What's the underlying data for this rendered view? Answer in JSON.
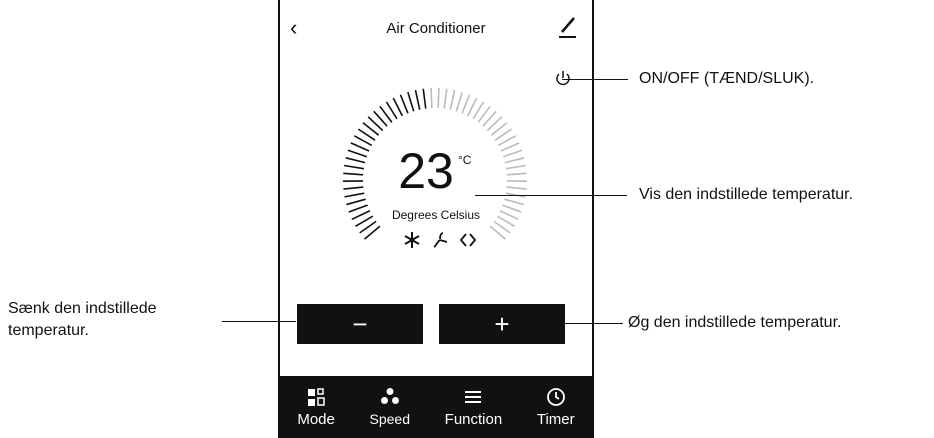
{
  "app": {
    "back_icon": "chevron-left-icon",
    "title": "Air Conditioner",
    "edit_icon": "pencil-icon",
    "power_icon": "power-icon"
  },
  "temperature": {
    "value": "23",
    "unit": "°C",
    "caption": "Degrees Celsius"
  },
  "status_icons": [
    "snowflake-icon",
    "fan-icon",
    "auto-swing-icon"
  ],
  "controls": {
    "minus_label": "−",
    "plus_label": "+"
  },
  "tabs": [
    {
      "label": "Mode",
      "icon": "mode-icon"
    },
    {
      "label": "Speed",
      "icon": "fan-icon"
    },
    {
      "label": "Function",
      "icon": "menu-icon"
    },
    {
      "label": "Timer",
      "icon": "clock-icon"
    }
  ],
  "annotations": {
    "power": "ON/OFF (TÆND/SLUK).",
    "temperature": "Vis den indstillede temperatur.",
    "decrease_line1": "Sænk den indstillede",
    "decrease_line2": "temperatur.",
    "increase": "Øg den indstillede temperatur."
  }
}
